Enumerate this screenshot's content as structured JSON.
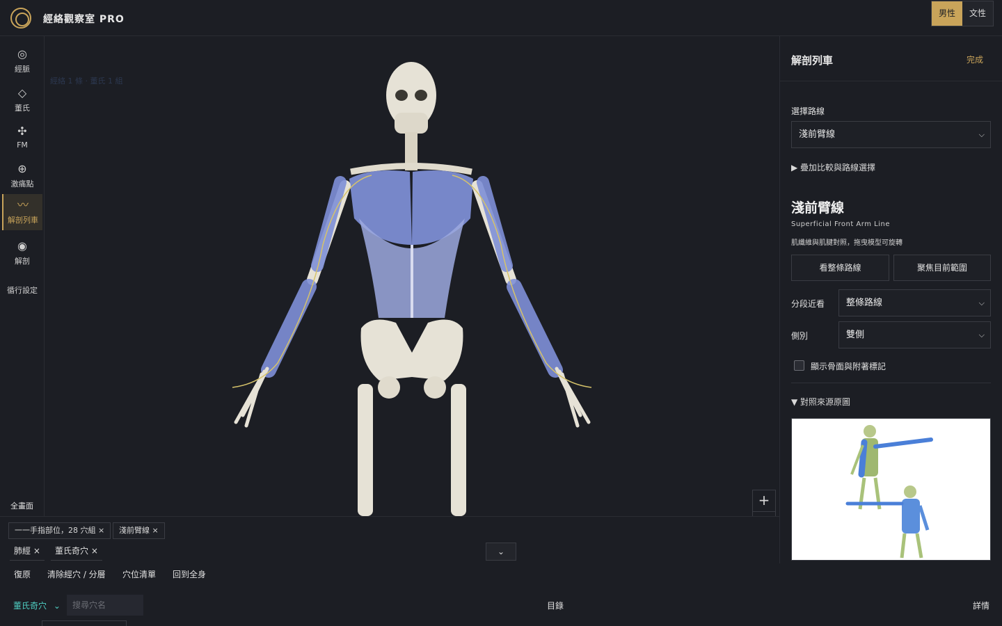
{
  "header": {
    "app_title": "經絡觀察室 PRO",
    "gender_male": "男性",
    "gender_female": "文性"
  },
  "sidebar": {
    "items": [
      {
        "label": "經脈",
        "icon": "target-icon"
      },
      {
        "label": "董氏",
        "icon": "diamond-icon"
      },
      {
        "label": "FM",
        "icon": "move-icon"
      },
      {
        "label": "激痛點",
        "icon": "plus-circle-icon"
      },
      {
        "label": "解剖列車",
        "icon": "wave-icon",
        "active": true
      },
      {
        "label": "解剖",
        "icon": "dot-circle-icon"
      }
    ],
    "settings_label": "循行設定",
    "fullscreen_label": "全畫面"
  },
  "viewport": {
    "ghost_text": "經絡 1 條 · 董氏 1 組",
    "zoom_in_label": "+"
  },
  "panel": {
    "title": "解剖列車",
    "done_label": "完成",
    "select_route_label": "選擇路線",
    "route_value": "淺前臂線",
    "overlay_toggle": "▶ 疊加比較與路線選擇",
    "line_name": "淺前臂線",
    "line_name_en": "Superficial Front Arm Line",
    "line_desc": "肌纖維與肌腱對照，拖曳模型可旋轉",
    "btn_view_all": "看整條路線",
    "btn_focus": "聚焦目前範圍",
    "segment_label": "分段近看",
    "segment_value": "整條路線",
    "side_label": "側別",
    "side_value": "雙側",
    "checkbox_label": "顯示骨面與附著標記",
    "reference_toggle": "▼ 對照來源原圖"
  },
  "bottom": {
    "chips": [
      "一一手指部位，28 穴組 ×",
      "淺前臂線 ×"
    ],
    "tags": [
      "肺經 ×",
      "董氏奇穴 ×"
    ],
    "actions": [
      "復原",
      "清除經穴 / 分層",
      "穴位清單",
      "回到全身"
    ],
    "collapse_icon": "⌄",
    "category_tab": "董氏奇穴",
    "search_placeholder": "搜尋穴名",
    "catalog_label": "目錄",
    "details_label": "詳情"
  },
  "colors": {
    "accent": "#c9a45a",
    "teal": "#4fd1c5",
    "muscle": "#7f90d8",
    "bone": "#e6e2d6"
  }
}
